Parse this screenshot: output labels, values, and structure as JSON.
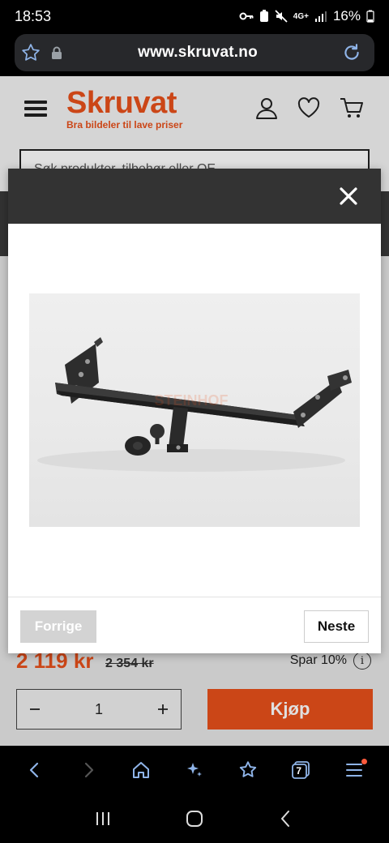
{
  "status_bar": {
    "time": "18:53",
    "network": "4G+",
    "battery": "16%"
  },
  "browser": {
    "url": "www.skruvat.no",
    "tabs_count": "7"
  },
  "site": {
    "logo": "Skruvat",
    "tagline": "Bra bildeler til lave priser",
    "search_placeholder": "Søk produkter, tilbehør eller OE"
  },
  "product": {
    "price": "2 119 kr",
    "old_price": "2 354 kr",
    "savings": "Spar 10%",
    "quantity": "1",
    "buy_label": "Kjøp",
    "image_watermark": "STEINHOF"
  },
  "modal": {
    "prev_label": "Forrige",
    "next_label": "Neste"
  },
  "colors": {
    "brand": "#e8501b",
    "modal_header": "#333333"
  }
}
